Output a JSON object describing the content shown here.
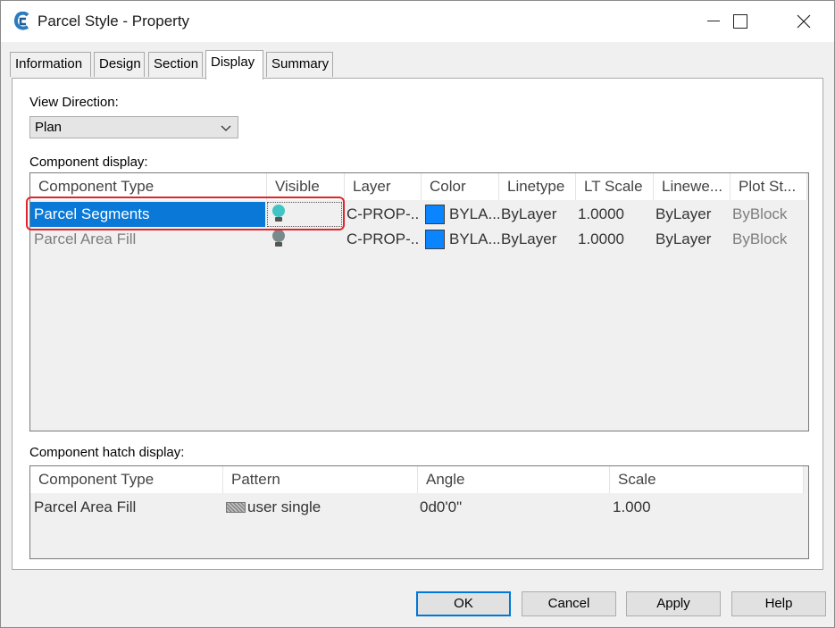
{
  "window": {
    "title": "Parcel Style - Property"
  },
  "tabs": [
    {
      "label": "Information"
    },
    {
      "label": "Design"
    },
    {
      "label": "Section"
    },
    {
      "label": "Display"
    },
    {
      "label": "Summary"
    }
  ],
  "active_tab": "Display",
  "view_direction": {
    "label": "View Direction:",
    "value": "Plan"
  },
  "component_display": {
    "label": "Component display:",
    "columns": [
      "Component Type",
      "Visible",
      "Layer",
      "Color",
      "Linetype",
      "LT Scale",
      "Linewe...",
      "Plot St..."
    ],
    "rows": [
      {
        "component_type": "Parcel Segments",
        "visible": "on",
        "layer": "C-PROP-...",
        "color": "BYLA...",
        "color_hex": "#0a84ff",
        "linetype": "ByLayer",
        "lt_scale": "1.0000",
        "lineweight": "ByLayer",
        "plot_style": "ByBlock",
        "selected": true
      },
      {
        "component_type": "Parcel Area Fill",
        "visible": "off",
        "layer": "C-PROP-...",
        "color": "BYLA...",
        "color_hex": "#0a84ff",
        "linetype": "ByLayer",
        "lt_scale": "1.0000",
        "lineweight": "ByLayer",
        "plot_style": "ByBlock",
        "selected": false
      }
    ]
  },
  "component_hatch_display": {
    "label": "Component hatch display:",
    "columns": [
      "Component Type",
      "Pattern",
      "Angle",
      "Scale"
    ],
    "rows": [
      {
        "component_type": "Parcel Area Fill",
        "pattern": "user single",
        "angle": "0d0'0\"",
        "scale": "1.000"
      }
    ]
  },
  "buttons": {
    "ok": "OK",
    "cancel": "Cancel",
    "apply": "Apply",
    "help": "Help"
  },
  "colors": {
    "selection": "#0a78d7",
    "highlight_box": "#e0242a",
    "bulb_on": "#40c4c4",
    "bulb_off": "#7a8a8a"
  }
}
